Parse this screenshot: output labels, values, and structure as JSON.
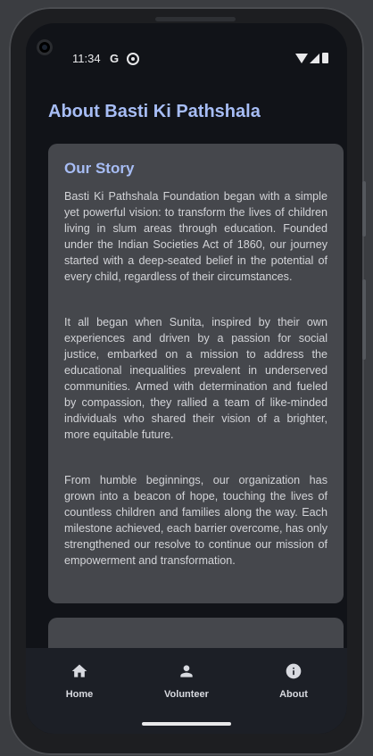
{
  "status_bar": {
    "time": "11:34",
    "g": "G"
  },
  "page": {
    "title": "About Basti Ki Pathshala"
  },
  "story_card": {
    "title": "Our Story",
    "paragraphs": [
      "Basti Ki Pathshala Foundation began with a simple yet powerful vision: to transform the lives of children living in slum areas through education. Founded under the Indian Societies Act of 1860, our journey started with a deep-seated belief in the potential of every child, regardless of their circumstances.",
      "It all began when Sunita, inspired by their own experiences and driven by a passion for social justice, embarked on a mission to address the educational inequalities prevalent in underserved communities. Armed with determination and fueled by compassion, they rallied a team of like-minded individuals who shared their vision of a brighter, more equitable future.",
      "From humble beginnings, our organization has grown into a beacon of hope, touching the lives of countless children and families along the way. Each milestone achieved, each barrier overcome, has only strengthened our resolve to continue our mission of empowerment and transformation."
    ]
  },
  "bottom_nav": {
    "items": [
      {
        "label": "Home",
        "icon": "home-icon"
      },
      {
        "label": "Volunteer",
        "icon": "person-icon"
      },
      {
        "label": "About",
        "icon": "info-icon"
      }
    ]
  },
  "colors": {
    "accent": "#a7bdf5",
    "card": "#45474c",
    "background": "#111318",
    "nav": "#1c1f26"
  }
}
